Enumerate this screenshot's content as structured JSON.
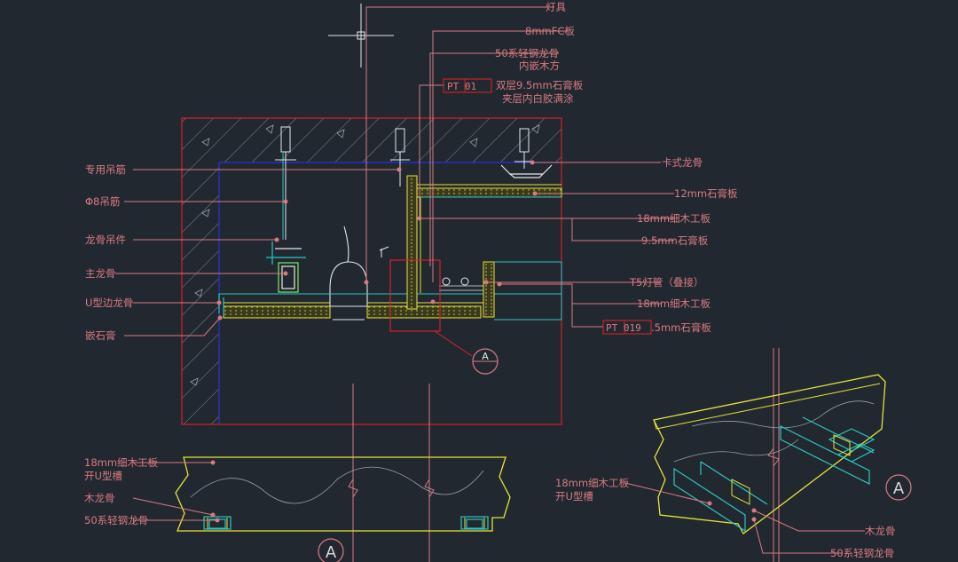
{
  "colors": {
    "background": "#212830",
    "leader": "#d97a80",
    "red": "#d8202a",
    "yellow": "#e6e23a",
    "cyan": "#2fc6c0",
    "blue": "#2732d8",
    "white": "#e8e8e8",
    "gray": "#9aa0a6",
    "green": "#7fe85b"
  },
  "top_labels": {
    "lamp": "灯具",
    "fc_board": "8mmFC板",
    "keel_line1": "50系轻钢龙骨",
    "keel_line2": "内嵌木方",
    "pt01_tag": "PT 01",
    "gypsum_line1": "双层9.5mm石膏板",
    "gypsum_line2": "夹层内白胶满涂"
  },
  "left_labels": {
    "hanger_rod": "专用吊筋",
    "phi8_rod": "Φ8吊筋",
    "keel_hanger": "龙骨吊件",
    "main_keel": "主龙骨",
    "u_edge_keel": "U型边龙骨",
    "inlay_gypsum": "嵌石膏"
  },
  "right_labels": {
    "clip_keel": "卡式龙骨",
    "gypsum_12": "12mm石膏板",
    "blockboard_18a": "18mm细木工板",
    "gypsum_95": "9.5mm石膏板",
    "t5_lamp": "T5灯管（叠接）",
    "blockboard_18b": "18mm细木工板",
    "pt019_tag": "PT 019",
    "pt019_text": ".5mm石膏板"
  },
  "detail_marker": "A",
  "bottom_left": {
    "board_line1": "18mm细木工板",
    "board_line2": "开U型槽",
    "wood_keel": "木龙骨",
    "steel_keel": "50系轻钢龙骨",
    "marker": "A"
  },
  "bottom_right": {
    "board_line1": "18mm细木工板",
    "board_line2": "开U型槽",
    "wood_keel": "木龙骨",
    "steel_keel": "50系轻钢龙骨",
    "marker": "A"
  }
}
